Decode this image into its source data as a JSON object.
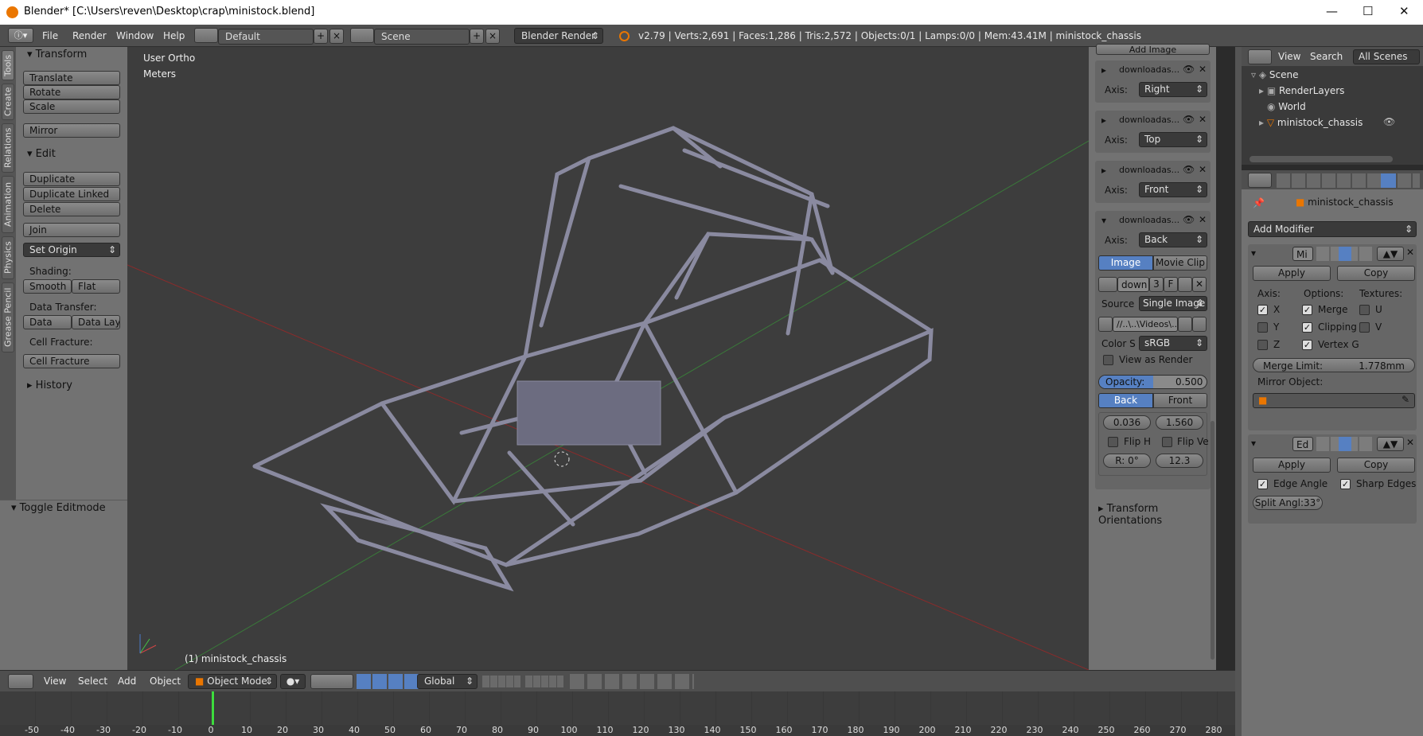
{
  "titlebar": {
    "title": "Blender* [C:\\Users\\reven\\Desktop\\crap\\ministock.blend]",
    "minimize": "—",
    "maximize": "☐",
    "close": "✕"
  },
  "infobar": {
    "menus": [
      "File",
      "Render",
      "Window",
      "Help"
    ],
    "layout": "Default",
    "scene": "Scene",
    "engine": "Blender Render",
    "stats": "v2.79 | Verts:2,691 | Faces:1,286 | Tris:2,572 | Objects:0/1 | Lamps:0/0 | Mem:43.41M | ministock_chassis"
  },
  "lefttabs": [
    "Tools",
    "Create",
    "Relations",
    "Animation",
    "Physics",
    "Grease Pencil"
  ],
  "toolshelf": {
    "transform_title": "Transform",
    "transform_buttons": [
      "Translate",
      "Rotate",
      "Scale"
    ],
    "mirror": "Mirror",
    "edit_title": "Edit",
    "edit_buttons": [
      "Duplicate",
      "Duplicate Linked",
      "Delete"
    ],
    "join": "Join",
    "set_origin": "Set Origin",
    "shading_label": "Shading:",
    "smooth": "Smooth",
    "flat": "Flat",
    "data_transfer_label": "Data Transfer:",
    "data": "Data",
    "data_layout": "Data Layo",
    "cell_fracture_label": "Cell Fracture:",
    "cell_fracture": "Cell Fracture",
    "history": "History",
    "toggle_editmode": "Toggle Editmode"
  },
  "viewport": {
    "view_name": "User Ortho",
    "units": "Meters",
    "object_label": "(1) ministock_chassis"
  },
  "npanel": {
    "add_image": "Add Image",
    "backgrounds": [
      {
        "name": "downloadas...",
        "axis_label": "Axis:",
        "axis": "Right"
      },
      {
        "name": "downloadas...",
        "axis_label": "Axis:",
        "axis": "Top"
      },
      {
        "name": "downloadas...",
        "axis_label": "Axis:",
        "axis": "Front"
      },
      {
        "name": "downloadas...",
        "axis_label": "Axis:",
        "axis": "Back"
      }
    ],
    "image_tab": "Image",
    "movieclip_tab": "Movie Clip",
    "img_name": "down",
    "img_users": "3",
    "img_f": "F",
    "source_label": "Source",
    "source": "Single Image",
    "path": "//..\\..\\Videos\\...",
    "colors_label": "Color S",
    "colors": "sRGB",
    "view_as_render": "View as Render",
    "opacity_label": "Opacity:",
    "opacity": "0.500",
    "back_btn": "Back",
    "front_btn": "Front",
    "offset_x": "0.036",
    "offset_y": "1.560",
    "flip_h": "Flip H",
    "flip_v": "Flip Ve",
    "rotation": "R:  0°",
    "size": "12.3",
    "transform_orientations": "Transform Orientations"
  },
  "outliner": {
    "menus": [
      "View",
      "Search"
    ],
    "scope": "All Scenes",
    "items": [
      {
        "label": "Scene"
      },
      {
        "label": "RenderLayers"
      },
      {
        "label": "World"
      },
      {
        "label": "ministock_chassis"
      }
    ]
  },
  "properties": {
    "object": "ministock_chassis",
    "add_modifier": "Add Modifier",
    "mirror_mod": {
      "name": "Mi",
      "apply": "Apply",
      "copy": "Copy",
      "axis_label": "Axis:",
      "options_label": "Options:",
      "textures_label": "Textures:",
      "x": "X",
      "y": "Y",
      "z": "Z",
      "merge": "Merge",
      "clipping": "Clipping",
      "vertex_g": "Vertex G",
      "u": "U",
      "v": "V",
      "merge_limit_label": "Merge Limit:",
      "merge_limit": "1.778mm",
      "mirror_object_label": "Mirror Object:"
    },
    "edgesplit_mod": {
      "name": "Ed",
      "apply": "Apply",
      "copy": "Copy",
      "edge_angle": "Edge Angle",
      "sharp_edges": "Sharp Edges",
      "split_angle": "Split Angl:33°"
    }
  },
  "vpheader": {
    "menus": [
      "View",
      "Select",
      "Add",
      "Object"
    ],
    "mode": "Object Mode",
    "orientation": "Global"
  },
  "timeline": {
    "ticks": [
      "-50",
      "-40",
      "-30",
      "-20",
      "-10",
      "0",
      "10",
      "20",
      "30",
      "40",
      "50",
      "60",
      "70",
      "80",
      "90",
      "100",
      "110",
      "120",
      "130",
      "140",
      "150",
      "160",
      "170",
      "180",
      "190",
      "200",
      "210",
      "220",
      "230",
      "240",
      "250",
      "260",
      "270",
      "280"
    ]
  },
  "colors": {
    "accent_blue": "#5680c2",
    "frame_green": "#3ddc3d",
    "blender_orange": "#ea7600"
  }
}
